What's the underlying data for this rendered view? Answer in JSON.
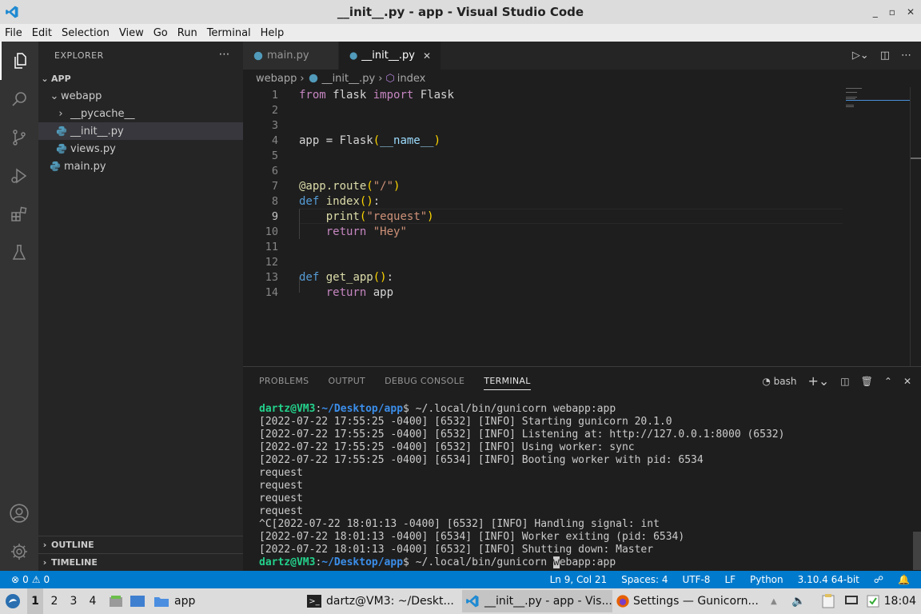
{
  "window": {
    "title": "__init__.py - app - Visual Studio Code",
    "controls": [
      "_",
      "▫",
      "✕"
    ]
  },
  "menu": [
    "File",
    "Edit",
    "Selection",
    "View",
    "Go",
    "Run",
    "Terminal",
    "Help"
  ],
  "explorer": {
    "header": "EXPLORER",
    "root": "APP",
    "items": [
      {
        "label": "webapp",
        "type": "folder-open"
      },
      {
        "label": "__pycache__",
        "type": "folder"
      },
      {
        "label": "__init__.py",
        "type": "file",
        "selected": true
      },
      {
        "label": "views.py",
        "type": "file"
      },
      {
        "label": "main.py",
        "type": "file"
      }
    ],
    "outline": "OUTLINE",
    "timeline": "TIMELINE"
  },
  "tabs": [
    {
      "label": "main.py",
      "active": false
    },
    {
      "label": "__init__.py",
      "active": true
    }
  ],
  "breadcrumb": {
    "folder": "webapp",
    "file": "__init__.py",
    "symbol": "index"
  },
  "code": {
    "line_numbers": [
      "1",
      "2",
      "3",
      "4",
      "5",
      "6",
      "7",
      "8",
      "9",
      "10",
      "11",
      "12",
      "13",
      "14"
    ],
    "current_line": "9"
  },
  "panel": {
    "tabs": [
      "PROBLEMS",
      "OUTPUT",
      "DEBUG CONSOLE",
      "TERMINAL"
    ],
    "active_tab": "TERMINAL",
    "shell": "bash"
  },
  "terminal": {
    "prompt_user": "dartz@VM3",
    "prompt_path": "~/Desktop/app",
    "command": "~/.local/bin/gunicorn webapp:app",
    "lines": [
      "[2022-07-22 17:55:25 -0400] [6532] [INFO] Starting gunicorn 20.1.0",
      "[2022-07-22 17:55:25 -0400] [6532] [INFO] Listening at: http://127.0.0.1:8000 (6532)",
      "[2022-07-22 17:55:25 -0400] [6532] [INFO] Using worker: sync",
      "[2022-07-22 17:55:25 -0400] [6534] [INFO] Booting worker with pid: 6534",
      "request",
      "request",
      "request",
      "request",
      "^C[2022-07-22 18:01:13 -0400] [6532] [INFO] Handling signal: int",
      "[2022-07-22 18:01:13 -0400] [6534] [INFO] Worker exiting (pid: 6534)",
      "[2022-07-22 18:01:13 -0400] [6532] [INFO] Shutting down: Master"
    ],
    "last_command_before_cursor": "~/.local/bin/gunicorn ",
    "cursor_char": "w",
    "last_command_after_cursor": "ebapp:app"
  },
  "status": {
    "errors": "0",
    "warnings": "0",
    "position": "Ln 9, Col 21",
    "spaces": "Spaces: 4",
    "encoding": "UTF-8",
    "eol": "LF",
    "language": "Python",
    "interpreter": "3.10.4 64-bit"
  },
  "taskbar": {
    "workspaces": [
      "1",
      "2",
      "3",
      "4"
    ],
    "folder": "app",
    "windows": [
      {
        "label": "dartz@VM3: ~/Deskt...",
        "active": false
      },
      {
        "label": "__init__.py - app - Vis...",
        "active": true
      },
      {
        "label": "Settings — Gunicorn...",
        "active": false
      }
    ],
    "clock": "18:04"
  },
  "colors": {
    "accent": "#007acc",
    "editor_bg": "#1e1e1e",
    "sidebar_bg": "#252526"
  }
}
